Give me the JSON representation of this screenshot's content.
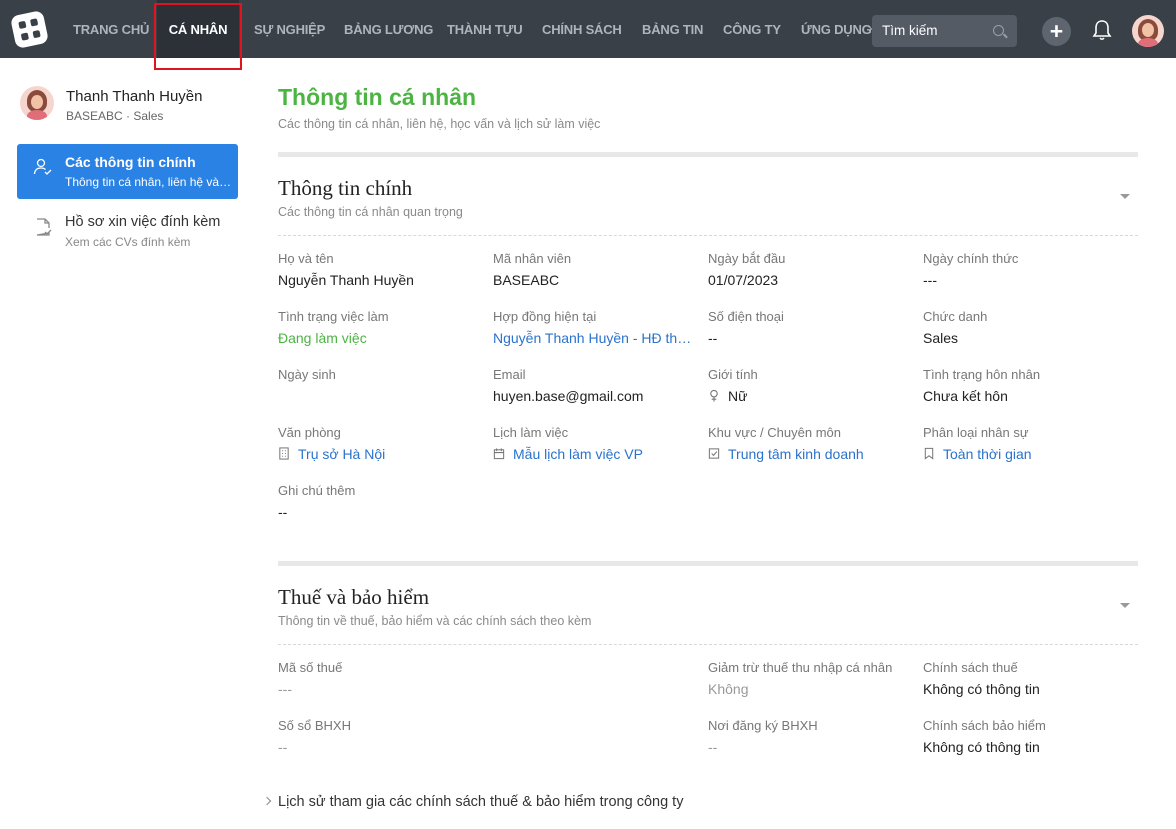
{
  "nav": {
    "items": [
      {
        "label": "TRANG CHỦ"
      },
      {
        "label": "CÁ NHÂN"
      },
      {
        "label": "SỰ NGHIỆP"
      },
      {
        "label": "BẢNG LƯƠNG"
      },
      {
        "label": "THÀNH TỰU"
      },
      {
        "label": "CHÍNH SÁCH"
      },
      {
        "label": "BẢNG TIN"
      },
      {
        "label": "CÔNG TY"
      },
      {
        "label": "ỨNG DỤNG"
      }
    ],
    "active": "CÁ NHÂN",
    "search_placeholder": "Tìm kiếm",
    "plus": "+"
  },
  "sidebar": {
    "user_name": "Thanh Thanh Huyền",
    "user_sub": "BASEABC · Sales",
    "items": [
      {
        "title": "Các thông tin chính",
        "sub": "Thông tin cá nhân, liên hệ và học vấn",
        "active": true
      },
      {
        "title": "Hồ sơ xin việc đính kèm",
        "sub": "Xem các CVs đính kèm",
        "active": false
      }
    ]
  },
  "page": {
    "title": "Thông tin cá nhân",
    "subtitle": "Các thông tin cá nhân, liên hệ, học vấn và lịch sử làm việc"
  },
  "main_info": {
    "title": "Thông tin chính",
    "subtitle": "Các thông tin cá nhân quan trọng",
    "fields": {
      "full_name": {
        "label": "Họ và tên",
        "value": "Nguyễn Thanh Huyền"
      },
      "employee_id": {
        "label": "Mã nhân viên",
        "value": "BASEABC"
      },
      "start_date": {
        "label": "Ngày bắt đầu",
        "value": "01/07/2023"
      },
      "official_date": {
        "label": "Ngày chính thức",
        "value": "---"
      },
      "job_status": {
        "label": "Tình trạng việc làm",
        "value": "Đang làm việc"
      },
      "contract": {
        "label": "Hợp đồng hiện tại",
        "value": "Nguyễn Thanh Huyền - HĐ thử việc"
      },
      "phone": {
        "label": "Số điện thoại",
        "value": "--"
      },
      "job_title": {
        "label": "Chức danh",
        "value": "Sales"
      },
      "dob": {
        "label": "Ngày sinh",
        "value": ""
      },
      "email": {
        "label": "Email",
        "value": "huyen.base@gmail.com"
      },
      "gender": {
        "label": "Giới tính",
        "value": "Nữ"
      },
      "marital": {
        "label": "Tình trạng hôn nhân",
        "value": "Chưa kết hôn"
      },
      "office": {
        "label": "Văn phòng",
        "value": "Trụ sở Hà Nội"
      },
      "schedule": {
        "label": "Lịch làm việc",
        "value": "Mẫu lịch làm việc VP"
      },
      "area": {
        "label": "Khu vực / Chuyên môn",
        "value": "Trung tâm kinh doanh"
      },
      "staff_type": {
        "label": "Phân loại nhân sự",
        "value": "Toàn thời gian"
      },
      "note": {
        "label": "Ghi chú thêm",
        "value": "--"
      }
    }
  },
  "tax": {
    "title": "Thuế và bảo hiểm",
    "subtitle": "Thông tin về thuế, bảo hiểm và các chính sách theo kèm",
    "fields": {
      "tax_code": {
        "label": "Mã số thuế",
        "value": "---"
      },
      "deduction": {
        "label": "Giảm trừ thuế thu nhập cá nhân",
        "value": "Không"
      },
      "tax_policy": {
        "label": "Chính sách thuế",
        "value": "Không có thông tin"
      },
      "si_number": {
        "label": "Số sổ BHXH",
        "value": "--"
      },
      "si_place": {
        "label": "Nơi đăng ký BHXH",
        "value": "--"
      },
      "insurance_policy": {
        "label": "Chính sách bảo hiểm",
        "value": "Không có thông tin"
      }
    },
    "history_link": "Lịch sử tham gia các chính sách thuế & bảo hiểm trong công ty"
  },
  "colors": {
    "accent_green": "#4cb443",
    "link_blue": "#2a73cc",
    "active_blue": "#2a82e4",
    "topbar": "#3a4048"
  }
}
